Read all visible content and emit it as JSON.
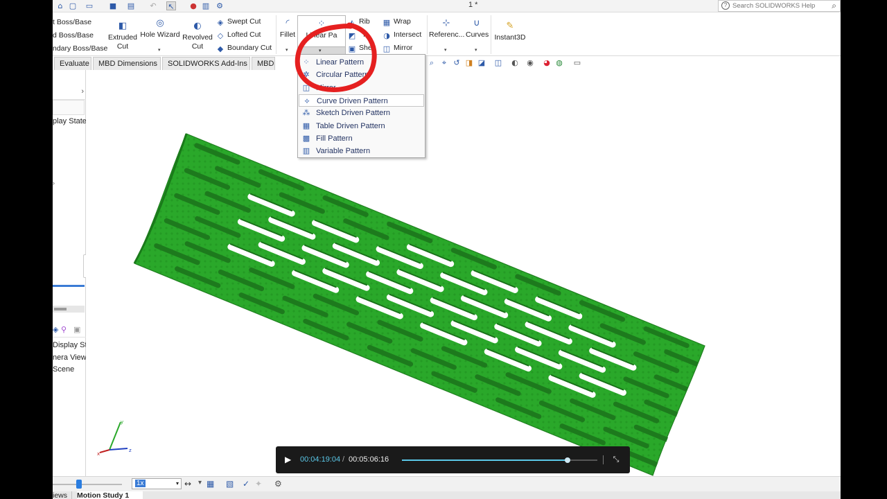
{
  "window": {
    "doc_title": "1 *"
  },
  "search": {
    "placeholder": "Search SOLIDWORKS Help"
  },
  "ribbon": {
    "boss_col": [
      "t Boss/Base",
      "d Boss/Base",
      "ndary Boss/Base"
    ],
    "extruded_cut": [
      "Extruded",
      "Cut"
    ],
    "hole_wizard": "Hole Wizard",
    "revolved_cut": [
      "Revolved",
      "Cut"
    ],
    "cut_col": [
      "Swept Cut",
      "Lofted Cut",
      "Boundary Cut"
    ],
    "fillet": "Fillet",
    "linear_pattern": "Linear Pa",
    "rib_col": [
      "Rib",
      "ft",
      "Shell"
    ],
    "wrap_col": [
      "Wrap",
      "Intersect",
      "Mirror"
    ],
    "reference": "Referenc...",
    "curves": "Curves",
    "instant3d": "Instant3D"
  },
  "tabs": [
    "Evaluate",
    "MBD Dimensions",
    "SOLIDWORKS Add-Ins",
    "MBD"
  ],
  "pattern_menu": {
    "items": [
      {
        "label": "Linear Pattern",
        "icon": "linear-pattern-icon"
      },
      {
        "label": "Circular Pattern",
        "icon": "circular-pattern-icon"
      },
      {
        "label": "Mirror",
        "icon": "mirror-icon"
      },
      {
        "label": "Curve Driven Pattern",
        "icon": "curve-driven-pattern-icon"
      },
      {
        "label": "Sketch Driven Pattern",
        "icon": "sketch-driven-pattern-icon"
      },
      {
        "label": "Table Driven Pattern",
        "icon": "table-driven-pattern-icon"
      },
      {
        "label": "Fill Pattern",
        "icon": "fill-pattern-icon"
      },
      {
        "label": "Variable Pattern",
        "icon": "variable-pattern-icon"
      }
    ],
    "hovered_index": 3
  },
  "left_panel": {
    "top_text": "play State",
    "bottom_items": [
      "Display St",
      "nera Views",
      "Scene"
    ]
  },
  "triad": {
    "x": "x",
    "y": "y",
    "z": "z"
  },
  "bottom": {
    "zoom_value": "1x",
    "tabs": [
      "iews",
      "Motion Study 1"
    ]
  },
  "player": {
    "current": "00:04:19:04",
    "separator": "/",
    "total": "00:05:06:16",
    "progress": 0.847
  },
  "colors": {
    "model": "#2aa82a",
    "model_dark": "#1e8a1e",
    "annotation_red": "#e52020",
    "accent_blue": "#2e5aa8"
  }
}
